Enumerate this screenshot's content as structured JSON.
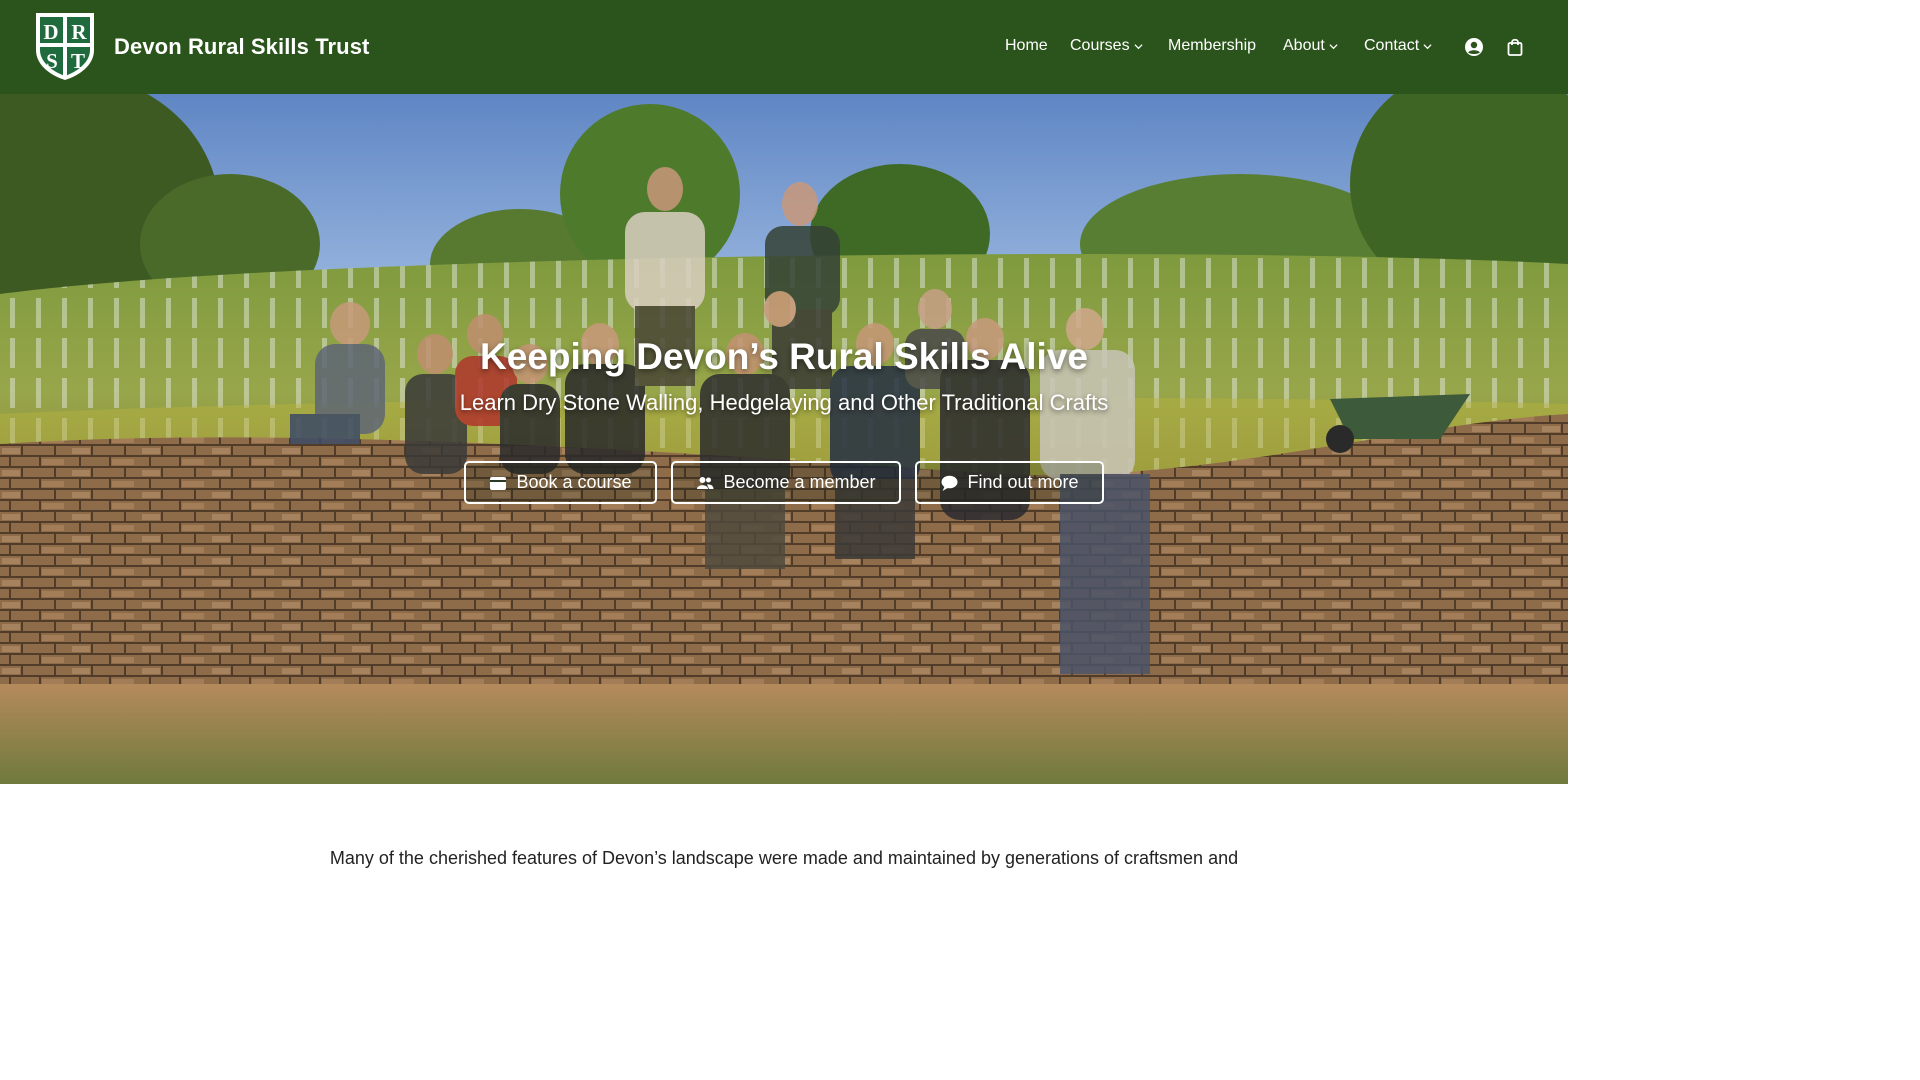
{
  "header": {
    "logo_letters": [
      "D",
      "R",
      "S",
      "T"
    ],
    "site_title": "Devon Rural Skills Trust",
    "nav": [
      {
        "label": "Home",
        "dropdown": false
      },
      {
        "label": "Courses",
        "dropdown": true
      },
      {
        "label": "Membership",
        "dropdown": false
      },
      {
        "label": "About",
        "dropdown": true
      },
      {
        "label": "Contact",
        "dropdown": true
      }
    ],
    "icons": [
      "account-icon",
      "shopping-bag-icon"
    ]
  },
  "hero": {
    "title": "Keeping Devon’s Rural Skills Alive",
    "subtitle": "Learn Dry Stone Walling, Hedgelaying and Other Traditional Crafts",
    "buttons": [
      {
        "label": "Book a course",
        "icon": "wallet-icon"
      },
      {
        "label": "Become a member",
        "icon": "users-icon"
      },
      {
        "label": "Find out more",
        "icon": "speech-bubble-icon"
      }
    ]
  },
  "intro": {
    "line1": "Many of the cherished features of Devon’s landscape were made and maintained by generations of craftsmen and"
  },
  "colors": {
    "header_bg": "#2a541b",
    "logo_shield": "#1f6b3e",
    "text_dark": "#222222",
    "white": "#ffffff"
  }
}
